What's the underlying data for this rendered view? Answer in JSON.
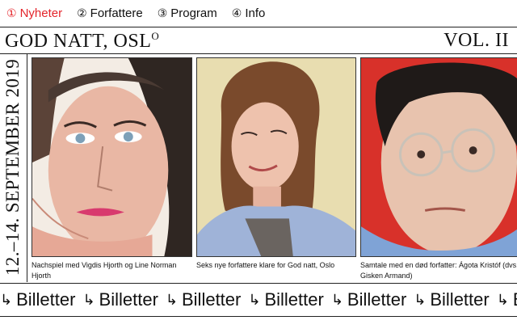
{
  "nav": {
    "items": [
      {
        "num": "①",
        "label": "Nyheter",
        "active": true
      },
      {
        "num": "②",
        "label": "Forfattere",
        "active": false
      },
      {
        "num": "③",
        "label": "Program",
        "active": false
      },
      {
        "num": "④",
        "label": "Info",
        "active": false
      }
    ]
  },
  "header": {
    "title": "GOD NATT, OSL",
    "title_sup": "O",
    "volume": "VOL. II"
  },
  "dates": "12.–14. SEPTEMBER 2019",
  "cards": [
    {
      "caption": "Nachspiel med Vigdis Hjorth og Line Norman Hjorth",
      "background": "#f3ece4"
    },
    {
      "caption": "Seks nye forfattere klare for God natt, Oslo",
      "background": "#e8ddb0"
    },
    {
      "caption": "Samtale med en død forfatter: Ágota Kristóf (dvs. Gisken Armand)",
      "background": "#d8312a"
    }
  ],
  "ticker": {
    "arrow": "↳",
    "label": "Billetter",
    "repeat": 8
  },
  "colors": {
    "accent": "#e4242a"
  }
}
